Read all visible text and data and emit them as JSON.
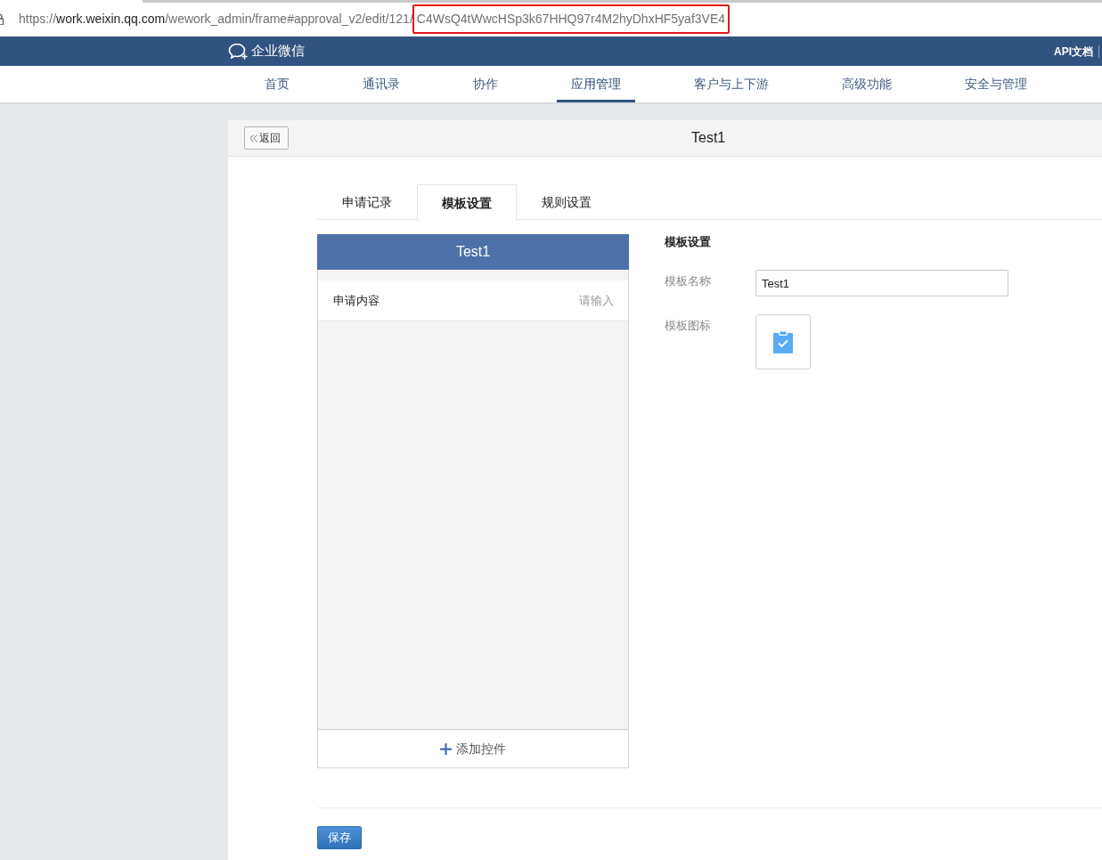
{
  "browser": {
    "url_parts": [
      {
        "kind": "muted",
        "text": "https://"
      },
      {
        "kind": "domain",
        "text": "work.weixin.qq.com"
      },
      {
        "kind": "muted",
        "text": "/wework_admin/frame#approval_v2/edit/121/"
      },
      {
        "kind": "highlighted",
        "text": "C4WsQ4tWwcHSp3k67HHQ97r4M2hyDhxHF5yaf3VE4"
      }
    ]
  },
  "header": {
    "logo_text": "企业微信",
    "links": [
      "API文档"
    ]
  },
  "nav": {
    "items": [
      {
        "label": "首页",
        "selected": false
      },
      {
        "label": "通讯录",
        "selected": false
      },
      {
        "label": "协作",
        "selected": false
      },
      {
        "label": "应用管理",
        "selected": true
      },
      {
        "label": "客户与上下游",
        "selected": false
      },
      {
        "label": "高级功能",
        "selected": false
      },
      {
        "label": "安全与管理",
        "selected": false
      }
    ]
  },
  "panel": {
    "back_label": "返回",
    "title": "Test1"
  },
  "tabs": [
    {
      "label": "申请记录",
      "selected": false
    },
    {
      "label": "模板设置",
      "selected": true
    },
    {
      "label": "规则设置",
      "selected": false
    }
  ],
  "preview": {
    "title": "Test1",
    "fields": [
      {
        "label": "申请内容",
        "placeholder": "请输入"
      }
    ],
    "add_label": "添加控件"
  },
  "settings": {
    "heading": "模板设置",
    "name_label": "模板名称",
    "name_value": "Test1",
    "icon_label": "模板图标"
  },
  "save_label": "保存"
}
